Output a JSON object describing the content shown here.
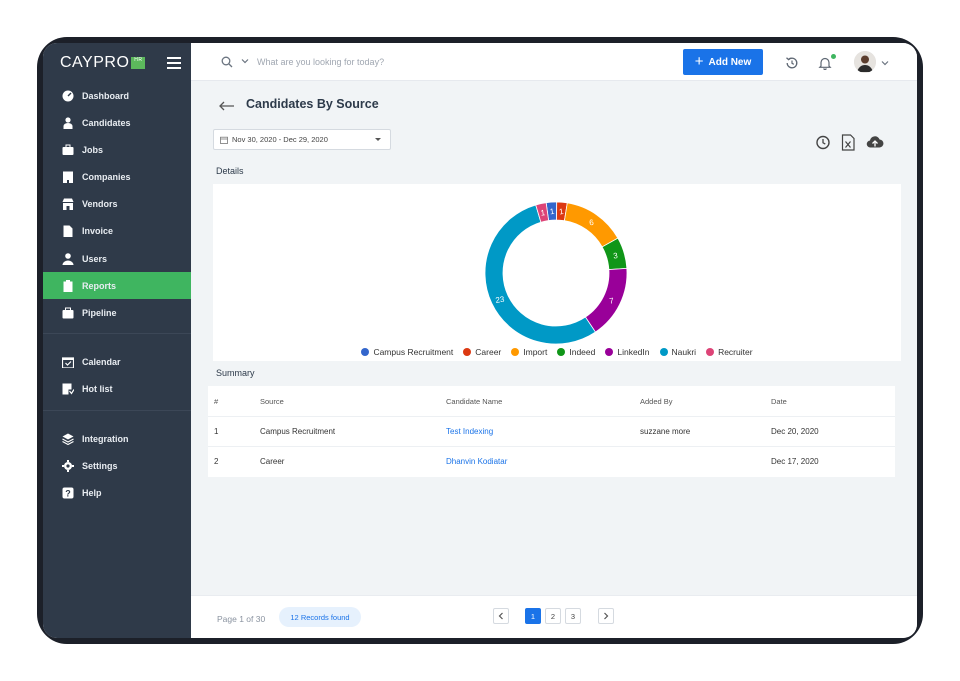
{
  "app": {
    "logo_text": "CAYPRO",
    "logo_badge": "HR"
  },
  "sidebar": {
    "items": [
      {
        "label": "Dashboard",
        "icon": "dashboard-icon"
      },
      {
        "label": "Candidates",
        "icon": "candidates-icon"
      },
      {
        "label": "Jobs",
        "icon": "jobs-icon"
      },
      {
        "label": "Companies",
        "icon": "companies-icon"
      },
      {
        "label": "Vendors",
        "icon": "vendors-icon"
      },
      {
        "label": "Invoice",
        "icon": "invoice-icon"
      },
      {
        "label": "Users",
        "icon": "users-icon"
      },
      {
        "label": "Reports",
        "icon": "reports-icon",
        "active": true
      },
      {
        "label": "Pipeline",
        "icon": "pipeline-icon"
      },
      {
        "label": "Calendar",
        "icon": "calendar-icon"
      },
      {
        "label": "Hot list",
        "icon": "hotlist-icon"
      },
      {
        "label": "Integration",
        "icon": "integration-icon"
      },
      {
        "label": "Settings",
        "icon": "settings-icon"
      },
      {
        "label": "Help",
        "icon": "help-icon"
      }
    ]
  },
  "topbar": {
    "search_placeholder": "What are you looking for today?",
    "add_new_label": "Add New"
  },
  "page": {
    "title": "Candidates By Source",
    "date_range": "Nov 30, 2020 - Dec 29, 2020",
    "details_label": "Details",
    "summary_label": "Summary"
  },
  "chart_data": {
    "type": "pie",
    "donut": true,
    "categories": [
      "Campus Recruitment",
      "Career",
      "Import",
      "Indeed",
      "LinkedIn",
      "Naukri",
      "Recruiter"
    ],
    "values": [
      1,
      1,
      6,
      3,
      7,
      23,
      1
    ],
    "colors": [
      "#3366cc",
      "#dc3912",
      "#ff9900",
      "#109618",
      "#990099",
      "#0099c6",
      "#dd4477"
    ],
    "legend_position": "bottom"
  },
  "table": {
    "columns": [
      "#",
      "Source",
      "Candidate Name",
      "Added By",
      "Date"
    ],
    "rows": [
      [
        "1",
        "Campus Recruitment",
        "Test Indexing",
        "suzzane more",
        "Dec 20, 2020"
      ],
      [
        "2",
        "Career",
        "Dhanvin Kodiatar",
        "",
        "Dec 17, 2020"
      ]
    ]
  },
  "footer": {
    "page_info": "Page 1 of 30",
    "records": "12 Records found",
    "pages": [
      "1",
      "2",
      "3"
    ],
    "current_page": "1"
  },
  "colors": {
    "sidebar_bg": "#2f3a49",
    "active": "#3fb560",
    "accent": "#1a73e8"
  }
}
